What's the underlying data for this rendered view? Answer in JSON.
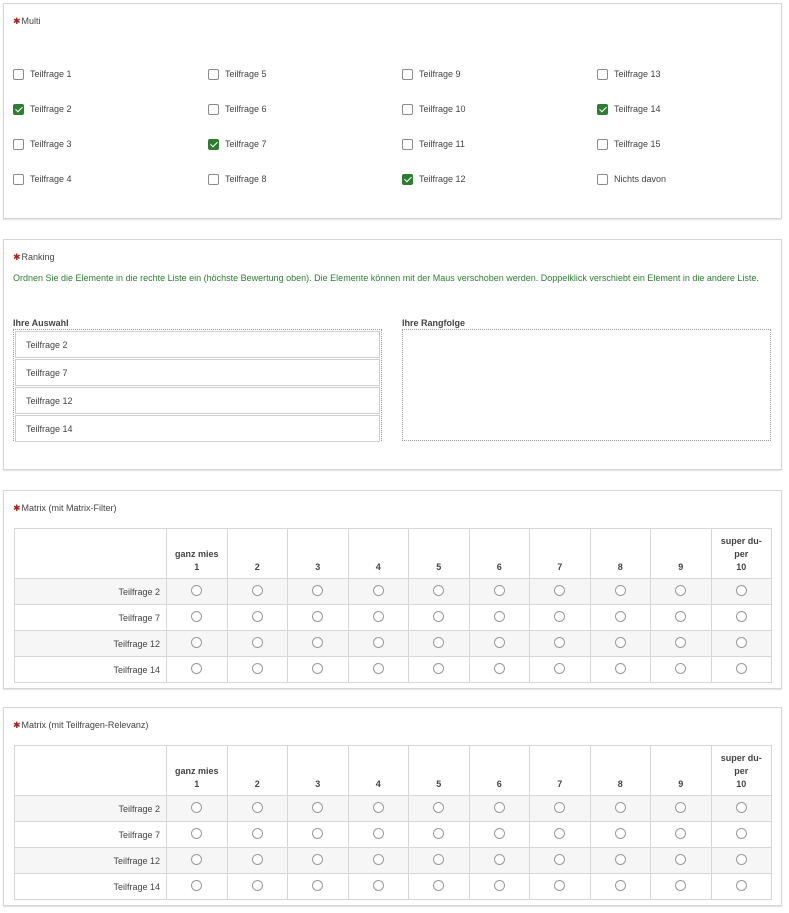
{
  "multi": {
    "title": "Multi",
    "options": [
      {
        "label": "Teilfrage 1",
        "checked": false
      },
      {
        "label": "Teilfrage 2",
        "checked": true
      },
      {
        "label": "Teilfrage 3",
        "checked": false
      },
      {
        "label": "Teilfrage 4",
        "checked": false
      },
      {
        "label": "Teilfrage 5",
        "checked": false
      },
      {
        "label": "Teilfrage 6",
        "checked": false
      },
      {
        "label": "Teilfrage 7",
        "checked": true
      },
      {
        "label": "Teilfrage 8",
        "checked": false
      },
      {
        "label": "Teilfrage 9",
        "checked": false
      },
      {
        "label": "Teilfrage 10",
        "checked": false
      },
      {
        "label": "Teilfrage 11",
        "checked": false
      },
      {
        "label": "Teilfrage 12",
        "checked": true
      },
      {
        "label": "Teilfrage 13",
        "checked": false
      },
      {
        "label": "Teilfrage 14",
        "checked": true
      },
      {
        "label": "Teilfrage 15",
        "checked": false
      },
      {
        "label": "Nichts davon",
        "checked": false
      }
    ]
  },
  "ranking": {
    "title": "Ranking",
    "instruction": "Ordnen Sie die Elemente in die rechte Liste ein (höchste Bewertung oben). Die Elemente können mit der Maus verschoben werden. Doppelklick verschiebt ein Element in die andere Liste.",
    "left_header": "Ihre Auswahl",
    "right_header": "Ihre Rangfolge",
    "items": [
      "Teilfrage 2",
      "Teilfrage 7",
      "Teilfrage 12",
      "Teilfrage 14"
    ]
  },
  "matrices": [
    {
      "title": "Matrix (mit Matrix-Filter)",
      "columns": [
        {
          "top": "ganz mies",
          "bottom": "1"
        },
        {
          "top": "",
          "bottom": "2"
        },
        {
          "top": "",
          "bottom": "3"
        },
        {
          "top": "",
          "bottom": "4"
        },
        {
          "top": "",
          "bottom": "5"
        },
        {
          "top": "",
          "bottom": "6"
        },
        {
          "top": "",
          "bottom": "7"
        },
        {
          "top": "",
          "bottom": "8"
        },
        {
          "top": "",
          "bottom": "9"
        },
        {
          "top": "super du-\nper",
          "bottom": "10"
        }
      ],
      "rows": [
        "Teilfrage 2",
        "Teilfrage 7",
        "Teilfrage 12",
        "Teilfrage 14"
      ]
    },
    {
      "title": "Matrix (mit Teilfragen-Relevanz)",
      "columns": [
        {
          "top": "ganz mies",
          "bottom": "1"
        },
        {
          "top": "",
          "bottom": "2"
        },
        {
          "top": "",
          "bottom": "3"
        },
        {
          "top": "",
          "bottom": "4"
        },
        {
          "top": "",
          "bottom": "5"
        },
        {
          "top": "",
          "bottom": "6"
        },
        {
          "top": "",
          "bottom": "7"
        },
        {
          "top": "",
          "bottom": "8"
        },
        {
          "top": "",
          "bottom": "9"
        },
        {
          "top": "super du-\nper",
          "bottom": "10"
        }
      ],
      "rows": [
        "Teilfrage 2",
        "Teilfrage 7",
        "Teilfrage 12",
        "Teilfrage 14"
      ]
    }
  ],
  "required_marker": "✱",
  "colors": {
    "required": "#a81f1f",
    "checked": "#2e7d32",
    "instruction": "#2e7d32"
  }
}
